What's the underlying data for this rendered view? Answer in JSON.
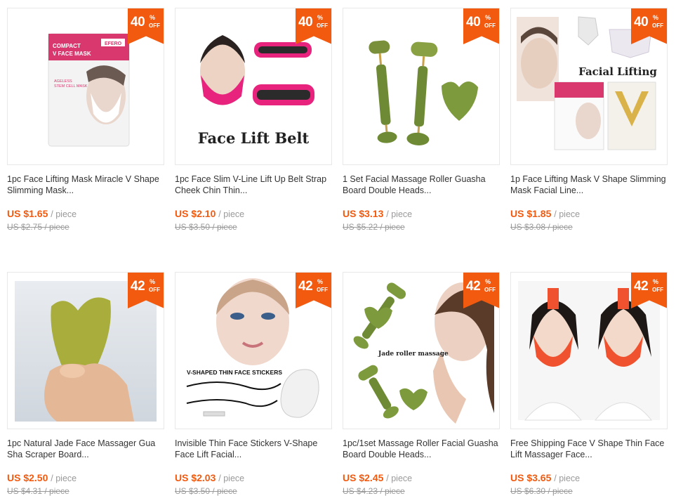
{
  "accent": "#f25a10",
  "badge_pct": "%",
  "badge_off": "OFF",
  "products": [
    {
      "discount": "40",
      "title": "1pc Face Lifting Mask Miracle V Shape\nSlimming Mask...",
      "price": "US $1.65",
      "unit": "/ piece",
      "original": "US $2.75 / piece",
      "image": {
        "brand": "EFERO",
        "pack_title": "COMPACT\nV FACE MASK",
        "pack_sub": "AGELESS\nSTEM CELL MASK"
      }
    },
    {
      "discount": "40",
      "title": "1pc Face Slim V-Line Lift Up Belt Strap\nCheek Chin Thin...",
      "price": "US $2.10",
      "unit": "/ piece",
      "original": "US $3.50 / piece",
      "image": {
        "caption": "Face Lift Belt"
      }
    },
    {
      "discount": "40",
      "title": "1 Set Facial Massage Roller Guasha\nBoard Double Heads...",
      "price": "US $3.13",
      "unit": "/ piece",
      "original": "US $5.22 / piece",
      "image": {}
    },
    {
      "discount": "40",
      "title": "1p Face Lifting Mask V Shape Slimming\nMask Facial Line...",
      "price": "US $1.85",
      "unit": "/ piece",
      "original": "US $3.08 / piece",
      "image": {
        "caption": "Facial Lifting"
      }
    },
    {
      "discount": "42",
      "title": "1pc Natural Jade Face Massager Gua\nSha Scraper Board...",
      "price": "US $2.50",
      "unit": "/ piece",
      "original": "US $4.31 / piece",
      "image": {}
    },
    {
      "discount": "42",
      "title": "Invisible Thin Face Stickers V-Shape\nFace Lift Facial...",
      "price": "US $2.03",
      "unit": "/ piece",
      "original": "US $3.50 / piece",
      "image": {
        "caption": "V-SHAPED THIN FACE STICKERS"
      }
    },
    {
      "discount": "42",
      "title": "1pc/1set Massage Roller Facial Guasha\nBoard Double Heads...",
      "price": "US $2.45",
      "unit": "/ piece",
      "original": "US $4.23 / piece",
      "image": {
        "caption": "Jade roller massage"
      }
    },
    {
      "discount": "42",
      "title": "Free Shipping Face V Shape Thin Face\nLift Massager Face...",
      "price": "US $3.65",
      "unit": "/ piece",
      "original": "US $6.30 / piece",
      "image": {}
    }
  ]
}
